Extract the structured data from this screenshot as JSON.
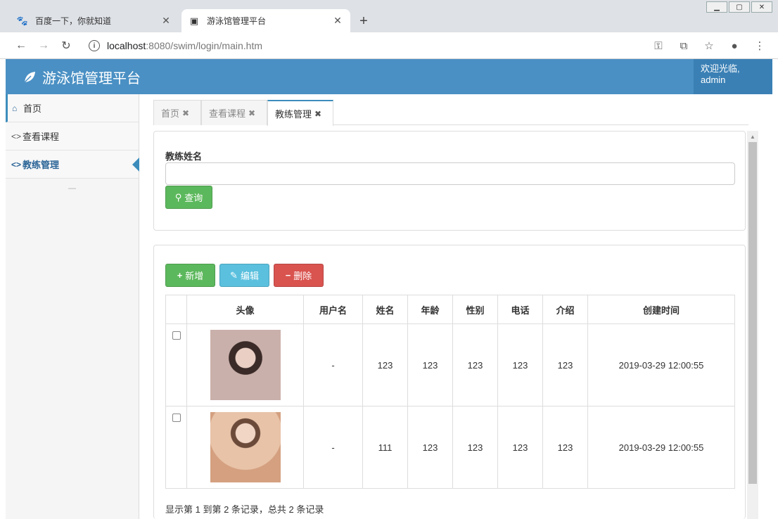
{
  "browser": {
    "tabs": [
      {
        "title": "百度一下，你就知道",
        "active": false
      },
      {
        "title": "游泳馆管理平台",
        "active": true
      }
    ],
    "url_host": "localhost",
    "url_path": ":8080/swim/login/main.htm"
  },
  "header": {
    "brand": "游泳馆管理平台",
    "welcome_line1": "欢迎光临,",
    "welcome_line2": "admin"
  },
  "sidebar": {
    "items": [
      {
        "label": "首页"
      },
      {
        "label": "查看课程"
      },
      {
        "label": "教练管理"
      }
    ],
    "collapse_label": "—"
  },
  "content_tabs": [
    {
      "label": "首页"
    },
    {
      "label": "查看课程"
    },
    {
      "label": "教练管理"
    }
  ],
  "search": {
    "label": "教练姓名",
    "value": "",
    "button": "查询"
  },
  "toolbar": {
    "add": "新增",
    "edit": "编辑",
    "delete": "删除"
  },
  "table": {
    "headers": [
      "头像",
      "用户名",
      "姓名",
      "年龄",
      "性别",
      "电话",
      "介绍",
      "创建时间"
    ],
    "rows": [
      {
        "username": "-",
        "name": "123",
        "age": "123",
        "gender": "123",
        "phone": "123",
        "intro": "123",
        "created": "2019-03-29 12:00:55"
      },
      {
        "username": "-",
        "name": "111",
        "age": "123",
        "gender": "123",
        "phone": "123",
        "intro": "123",
        "created": "2019-03-29 12:00:55"
      }
    ]
  },
  "pagination": {
    "summary": "显示第 1 到第 2 条记录，总共 2 条记录"
  },
  "colors": {
    "header_bg": "#4a90c4",
    "success": "#5cb85c",
    "info": "#5bc0de",
    "danger": "#d9534f"
  }
}
